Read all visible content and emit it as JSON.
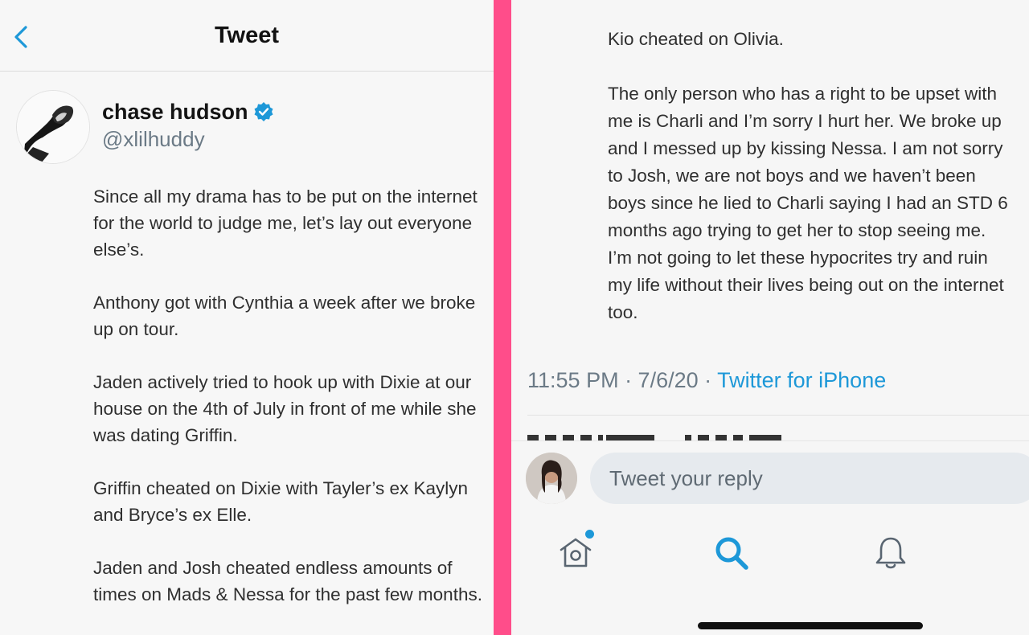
{
  "header": {
    "title": "Tweet",
    "back_icon": "chevron-left-icon"
  },
  "profile": {
    "display_name": "chase hudson",
    "handle": "@xlilhuddy",
    "verified_icon": "verified-badge-icon",
    "avatar": "avatar"
  },
  "tweet": {
    "paragraphs_left": [
      "Since all my drama has to be put on the internet for the world to judge me, let’s lay out everyone else’s.",
      "Anthony got with Cynthia a week after we broke up on tour.",
      "Jaden actively tried to hook up with Dixie at our house on the 4th of July in front of me while she was dating Griffin.",
      "Griffin cheated on Dixie with Tayler’s ex Kaylyn and Bryce’s ex Elle.",
      "Jaden and Josh cheated endless amounts of times on Mads & Nessa for the past few months."
    ],
    "paragraphs_right": [
      "Kio cheated on Olivia.",
      "The only person who has a right to be upset with me is Charli and I’m sorry I hurt her. We broke up and I messed up by kissing Nessa. I am not sorry to Josh, we are not boys and we haven’t been boys since he lied to Charli saying I had an STD 6 months ago trying to get her to stop seeing me. I’m not going to let these hypocrites try and ruin my life without their lives being out on the internet too."
    ],
    "timestamp": "11:55 PM · 7/6/20 · ",
    "source": "Twitter for iPhone"
  },
  "reply": {
    "placeholder": "Tweet your reply"
  },
  "nav": {
    "items": [
      "home-icon",
      "search-icon",
      "notifications-icon"
    ]
  },
  "colors": {
    "accent": "#1d98d8",
    "divider": "#ff4d8a",
    "muted": "#6b7a86"
  }
}
